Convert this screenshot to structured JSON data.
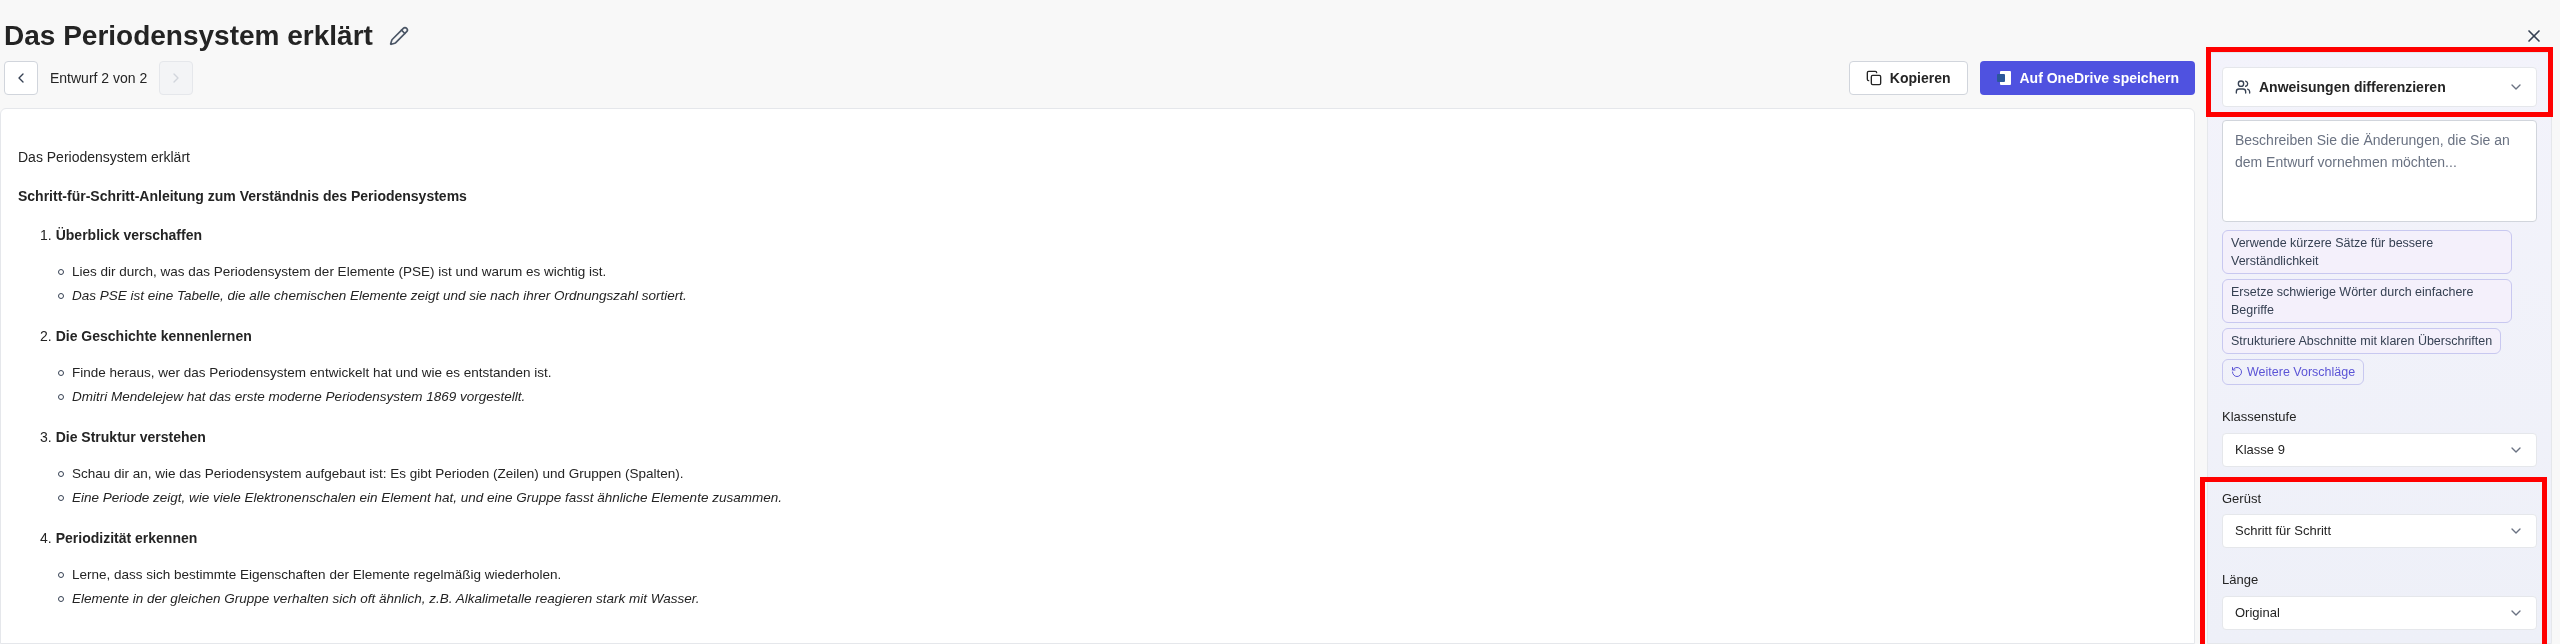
{
  "title": "Das Periodensystem erklärt",
  "draft_nav": {
    "label": "Entwurf 2 von 2",
    "prev_disabled": false,
    "next_disabled": true
  },
  "actions": [
    {
      "kind": "copy",
      "label": "Kopieren"
    },
    {
      "kind": "save",
      "label": "Auf OneDrive speichern"
    }
  ],
  "document": {
    "title": "Das Periodensystem erklärt",
    "heading": "Schritt-für-Schritt-Anleitung zum Verständnis des Periodensystems",
    "steps": [
      {
        "number": "1.",
        "title": "Überblick verschaffen",
        "bullets": [
          {
            "text": "Lies dir durch, was das Periodensystem der Elemente (PSE) ist und warum es wichtig ist.",
            "italic": false
          },
          {
            "text": "Das PSE ist eine Tabelle, die alle chemischen Elemente zeigt und sie nach ihrer Ordnungszahl sortiert.",
            "italic": true
          }
        ]
      },
      {
        "number": "2.",
        "title": "Die Geschichte kennenlernen",
        "bullets": [
          {
            "text": "Finde heraus, wer das Periodensystem entwickelt hat und wie es entstanden ist.",
            "italic": false
          },
          {
            "text": "Dmitri Mendelejew hat das erste moderne Periodensystem 1869 vorgestellt.",
            "italic": true
          }
        ]
      },
      {
        "number": "3.",
        "title": "Die Struktur verstehen",
        "bullets": [
          {
            "text": "Schau dir an, wie das Periodensystem aufgebaut ist: Es gibt Perioden (Zeilen) und Gruppen (Spalten).",
            "italic": false
          },
          {
            "text": "Eine Periode zeigt, wie viele Elektronenschalen ein Element hat, und eine Gruppe fasst ähnliche Elemente zusammen.",
            "italic": true
          }
        ]
      },
      {
        "number": "4.",
        "title": "Periodizität erkennen",
        "bullets": [
          {
            "text": "Lerne, dass sich bestimmte Eigenschaften der Elemente regelmäßig wiederholen.",
            "italic": false
          },
          {
            "text": "Elemente in der gleichen Gruppe verhalten sich oft ähnlich, z.B. Alkalimetalle reagieren stark mit Wasser.",
            "italic": true
          }
        ]
      }
    ]
  },
  "panel": {
    "mode_dropdown": {
      "value": "Anweisungen differenzieren",
      "highlighted": true
    },
    "prompt": {
      "placeholder": "Beschreiben Sie die Änderungen, die Sie an dem Entwurf vornehmen möchten..."
    },
    "suggestions": [
      "Verwende kürzere Sätze für bessere Verständlichkeit",
      "Ersetze schwierige Wörter durch einfachere Begriffe",
      "Strukturiere Abschnitte mit klaren Überschriften"
    ],
    "more_suggestions": "Weitere Vorschläge",
    "setting_groups": [
      {
        "highlighted": false,
        "fields": [
          {
            "label": "Klassenstufe",
            "value": "Klasse 9"
          }
        ]
      },
      {
        "highlighted": true,
        "fields": [
          {
            "label": "Gerüst",
            "value": "Schritt für Schritt"
          },
          {
            "label": "Länge",
            "value": "Original"
          }
        ]
      }
    ]
  }
}
